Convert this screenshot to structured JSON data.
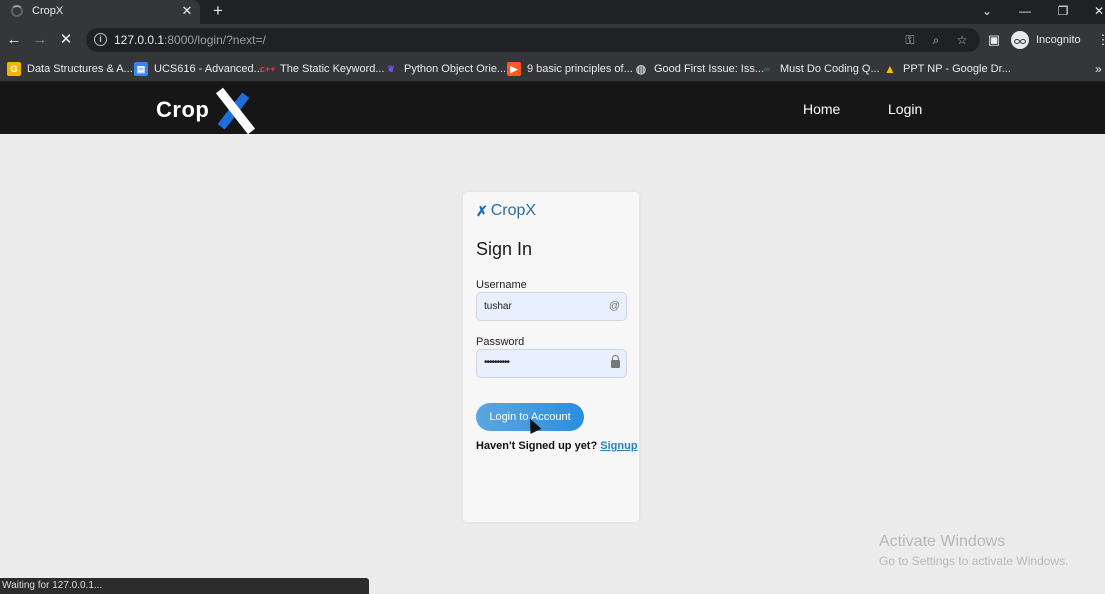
{
  "browser": {
    "tab_title": "CropX",
    "tab_close": "✕",
    "new_tab": "+",
    "url_host": "127.0.0.1",
    "url_path": ":8000/login/?next=/",
    "incognito_label": "Incognito",
    "status_text": "Waiting for 127.0.0.1...",
    "bookmarks": [
      {
        "label": "Data Structures & A...",
        "icon": "gfg-icon",
        "color": "#f4b400"
      },
      {
        "label": "UCS616 - Advanced...",
        "icon": "doc-icon",
        "color": "#3b82f6"
      },
      {
        "label": "The Static Keyword...",
        "icon": "cpp-icon",
        "color": "#e53935"
      },
      {
        "label": "Python Object Orie...",
        "icon": "feather-icon",
        "color": "#7c4dff"
      },
      {
        "label": "9 basic principles of...",
        "icon": "video-icon",
        "color": "#ff5722"
      },
      {
        "label": "Good First Issue: Iss...",
        "icon": "globe-icon",
        "color": "#bdc1c6"
      },
      {
        "label": "Must Do Coding Q...",
        "icon": "gfg-icon",
        "color": "#2e7d32"
      },
      {
        "label": "PPT NP - Google Dr...",
        "icon": "drive-icon",
        "color": "#fbbc04"
      }
    ]
  },
  "site": {
    "logo_text": "Crop",
    "nav": {
      "home": "Home",
      "login": "Login"
    },
    "brand_name": "CropX",
    "login_form": {
      "title": "Sign In",
      "username_label": "Username",
      "username_value": "tushar",
      "password_label": "Password",
      "password_value": "••••••••••",
      "submit_label": "Login to Account",
      "signup_prompt": "Haven't Signed up yet?",
      "signup_link": "Signup"
    }
  },
  "os": {
    "activate_title": "Activate Windows",
    "activate_sub": "Go to Settings to activate Windows."
  }
}
